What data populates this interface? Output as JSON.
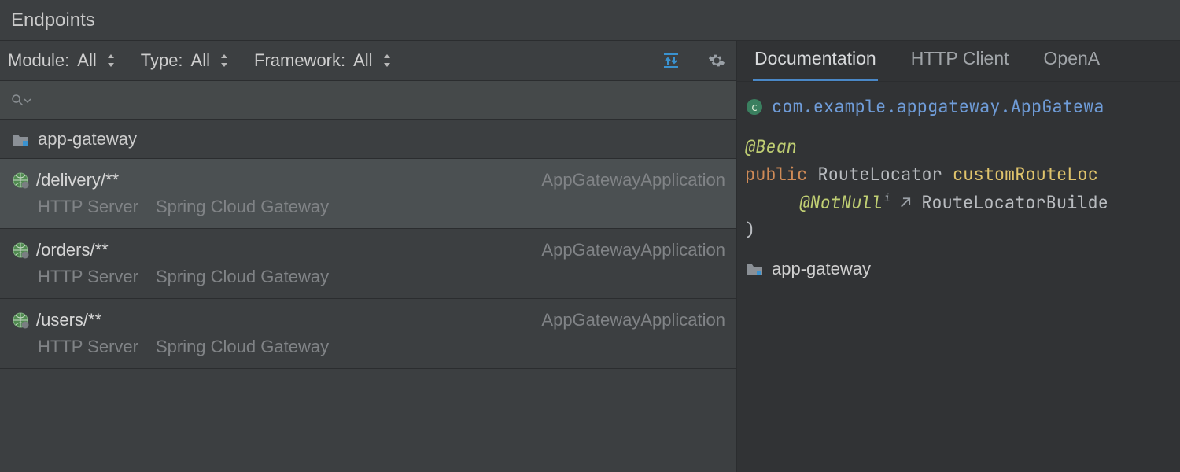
{
  "title": "Endpoints",
  "filters": {
    "module_label": "Module:",
    "module_value": "All",
    "type_label": "Type:",
    "type_value": "All",
    "framework_label": "Framework:",
    "framework_value": "All"
  },
  "search": {
    "placeholder": ""
  },
  "group": {
    "name": "app-gateway"
  },
  "endpoints": [
    {
      "path": "/delivery/**",
      "app": "AppGatewayApplication",
      "server": "HTTP Server",
      "framework": "Spring Cloud Gateway",
      "selected": true
    },
    {
      "path": "/orders/**",
      "app": "AppGatewayApplication",
      "server": "HTTP Server",
      "framework": "Spring Cloud Gateway",
      "selected": false
    },
    {
      "path": "/users/**",
      "app": "AppGatewayApplication",
      "server": "HTTP Server",
      "framework": "Spring Cloud Gateway",
      "selected": false
    }
  ],
  "right": {
    "tabs": [
      {
        "label": "Documentation",
        "active": true
      },
      {
        "label": "HTTP Client",
        "active": false
      },
      {
        "label": "OpenA",
        "active": false
      }
    ],
    "fqcn": "com.example.appgateway.AppGatewa",
    "code": {
      "ann_bean": "@Bean",
      "kw_public": "public",
      "ret_type": "RouteLocator",
      "fn_name": "customRouteLoc",
      "ann_notnull": "@NotNull",
      "arrow": "↗",
      "param_type": "RouteLocatorBuilde",
      "close_paren": ")"
    },
    "module": "app-gateway"
  }
}
